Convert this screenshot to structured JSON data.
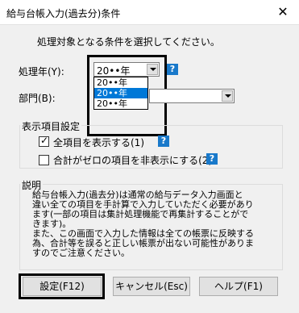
{
  "window": {
    "title": "給与台帳入力(過去分)条件",
    "close_glyph": "✕"
  },
  "instruction": "処理対象となる条件を選択してください。",
  "year": {
    "label": "処理年(Y):",
    "selected": "20••年",
    "options": [
      "20••年",
      "20••年",
      "20••年"
    ],
    "selected_index": 1
  },
  "department": {
    "label": "部門(B):"
  },
  "display_settings": {
    "title": "表示項目設定",
    "show_all": {
      "label": "全項目を表示する(1)",
      "checked": true
    },
    "hide_zero": {
      "label": "合計がゼロの項目を非表示にする(2)",
      "checked": false
    }
  },
  "description": {
    "title": "説明",
    "lines": [
      "給与台帳入力(過去分)は通常の給与データ入力画面と",
      "違い全ての項目を手計算で入力していただく必要があり",
      "ます(一部の項目は集計処理機能で再集計することがで",
      "きます)。",
      "また、この画面で入力した情報は全ての帳票に反映する",
      "為、合計等を誤ると正しい帳票が出ない可能性がありま",
      "すのでご注意ください。"
    ]
  },
  "buttons": {
    "settings": "設定(F12)",
    "cancel": "キャンセル(Esc)",
    "help": "ヘルプ(F1)"
  },
  "help_glyph": "?"
}
